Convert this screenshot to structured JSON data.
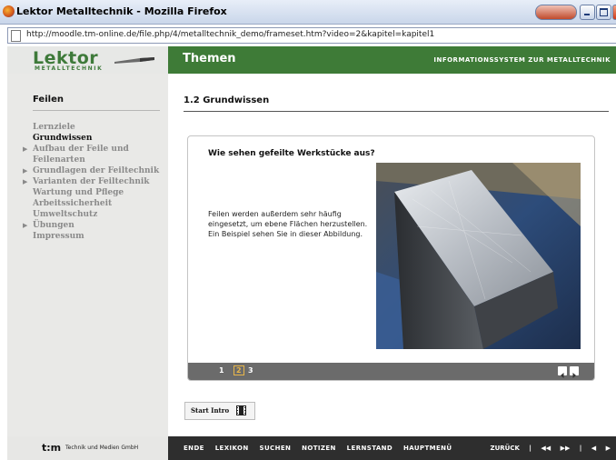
{
  "window": {
    "title": "Lektor Metalltechnik - Mozilla Firefox",
    "url": "http://moodle.tm-online.de/file.php/4/metalltechnik_demo/frameset.htm?video=2&kapitel=kapitel1"
  },
  "header": {
    "logo_main": "Lektor",
    "logo_sub": "METALLTECHNIK",
    "section": "Themen",
    "info": "INFORMATIONSSYSTEM ZUR METALLTECHNIK"
  },
  "sidebar": {
    "title": "Feilen",
    "items": [
      {
        "label": "Lernziele",
        "expandable": false,
        "active": false
      },
      {
        "label": "Grundwissen",
        "expandable": false,
        "active": true
      },
      {
        "label": "Aufbau der Feile und Feilenarten",
        "expandable": true,
        "active": false
      },
      {
        "label": "Grundlagen der Feiltechnik",
        "expandable": true,
        "active": false
      },
      {
        "label": "Varianten der Feiltechnik",
        "expandable": true,
        "active": false
      },
      {
        "label": "Wartung und Pflege",
        "expandable": false,
        "active": false
      },
      {
        "label": "Arbeitssicherheit",
        "expandable": false,
        "active": false
      },
      {
        "label": "Umweltschutz",
        "expandable": false,
        "active": false
      },
      {
        "label": "Übungen",
        "expandable": true,
        "active": false
      },
      {
        "label": "Impressum",
        "expandable": false,
        "active": false
      }
    ]
  },
  "content": {
    "title": "1.2 Grundwissen",
    "card": {
      "question": "Wie sehen gefeilte Werkstücke aus?",
      "body": "Feilen werden außerdem sehr häufig eingesetzt, um ebene Flächen herzustellen. Ein Beispiel sehen Sie in dieser Abbildung.",
      "pages": [
        "1",
        "2",
        "3"
      ],
      "current_page": "2"
    },
    "start_button": "Start Intro"
  },
  "footer": {
    "brand": "t:m",
    "brand_text": "Technik und Medien GmbH",
    "links": [
      "ENDE",
      "LEXIKON",
      "SUCHEN",
      "NOTIZEN",
      "LERNSTAND",
      "HAUPTMENÜ"
    ],
    "zurueck": "ZURÜCK"
  }
}
